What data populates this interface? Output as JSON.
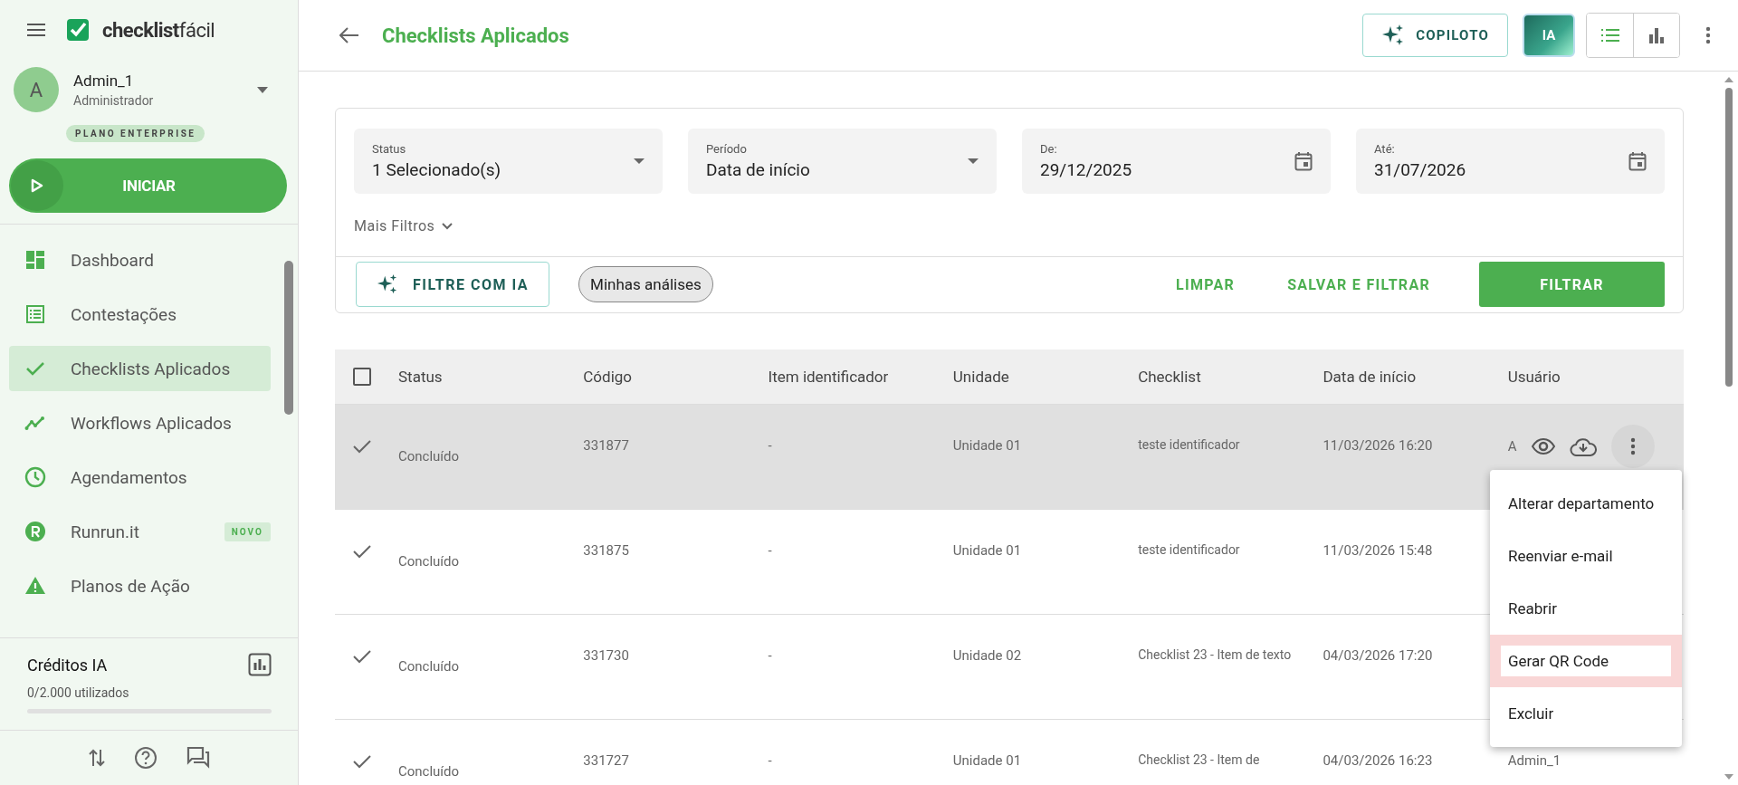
{
  "sidebar": {
    "logo": "**checklist**fácil",
    "user": {
      "avatar_letter": "A",
      "name": "Admin_1",
      "role": "Administrador"
    },
    "plan_badge": "PLANO ENTERPRISE",
    "start_button": "INICIAR",
    "nav": [
      {
        "label": "Dashboard",
        "selected": false
      },
      {
        "label": "Contestações",
        "selected": false
      },
      {
        "label": "Checklists Aplicados",
        "selected": true
      },
      {
        "label": "Workflows Aplicados",
        "selected": false
      },
      {
        "label": "Agendamentos",
        "selected": false
      },
      {
        "label": "Runrun.it",
        "selected": false,
        "badge": "NOVO"
      },
      {
        "label": "Planos de Ação",
        "selected": false
      }
    ],
    "credits": {
      "title": "Créditos IA",
      "usage": "0/2.000 utilizados",
      "level": 0
    }
  },
  "header": {
    "title": "Checklists Aplicados",
    "copilot_button": "COPILOTO",
    "ia_button": "IA",
    "views": [
      {
        "kind": "list",
        "selected": true
      },
      {
        "kind": "chart",
        "selected": false
      }
    ]
  },
  "filters": {
    "fields": [
      {
        "kind": "select",
        "label": "Status",
        "value": "1 Selecionado(s)"
      },
      {
        "kind": "select",
        "label": "Período",
        "value": "Data de início"
      },
      {
        "kind": "date",
        "label": "De:",
        "value": "29/12/2025"
      },
      {
        "kind": "date",
        "label": "Até:",
        "value": "31/07/2026"
      }
    ],
    "more_filters": "Mais Filtros",
    "ai_filter_button": "FILTRE COM IA",
    "chip": "Minhas análises",
    "clear_button": "LIMPAR",
    "save_button": "SALVAR E FILTRAR",
    "apply_button": "FILTRAR"
  },
  "table": {
    "select_all_checked": false,
    "columns": [
      "Status",
      "Código",
      "Item identificador",
      "Unidade",
      "Checklist",
      "Data de início",
      "Usuário"
    ],
    "rows": [
      {
        "selected": true,
        "status": "Concluído",
        "code": "331877",
        "identifier": "-",
        "unit": "Unidade 01",
        "checklist": "teste identificador",
        "start_date": "11/03/2026 16:20",
        "user": "A"
      },
      {
        "selected": false,
        "status": "Concluído",
        "code": "331875",
        "identifier": "-",
        "unit": "Unidade 01",
        "checklist": "teste identificador",
        "start_date": "11/03/2026 15:48"
      },
      {
        "selected": false,
        "status": "Concluído",
        "code": "331730",
        "identifier": "-",
        "unit": "Unidade 02",
        "checklist": "Checklist 23 - Item de texto",
        "start_date": "04/03/2026 17:20"
      },
      {
        "selected": false,
        "status": "Concluído",
        "code": "331727",
        "identifier": "-",
        "unit": "Unidade 01",
        "checklist": "Checklist 23 - Item de",
        "start_date": "04/03/2026 16:23",
        "user": "Admin_1"
      }
    ]
  },
  "context_menu": [
    {
      "label": "Alterar departamento",
      "selected": false
    },
    {
      "label": "Reenviar e-mail",
      "selected": false
    },
    {
      "label": "Reabrir",
      "selected": false
    },
    {
      "label": "Gerar QR Code",
      "selected": true
    },
    {
      "label": "Excluir",
      "selected": false
    }
  ]
}
